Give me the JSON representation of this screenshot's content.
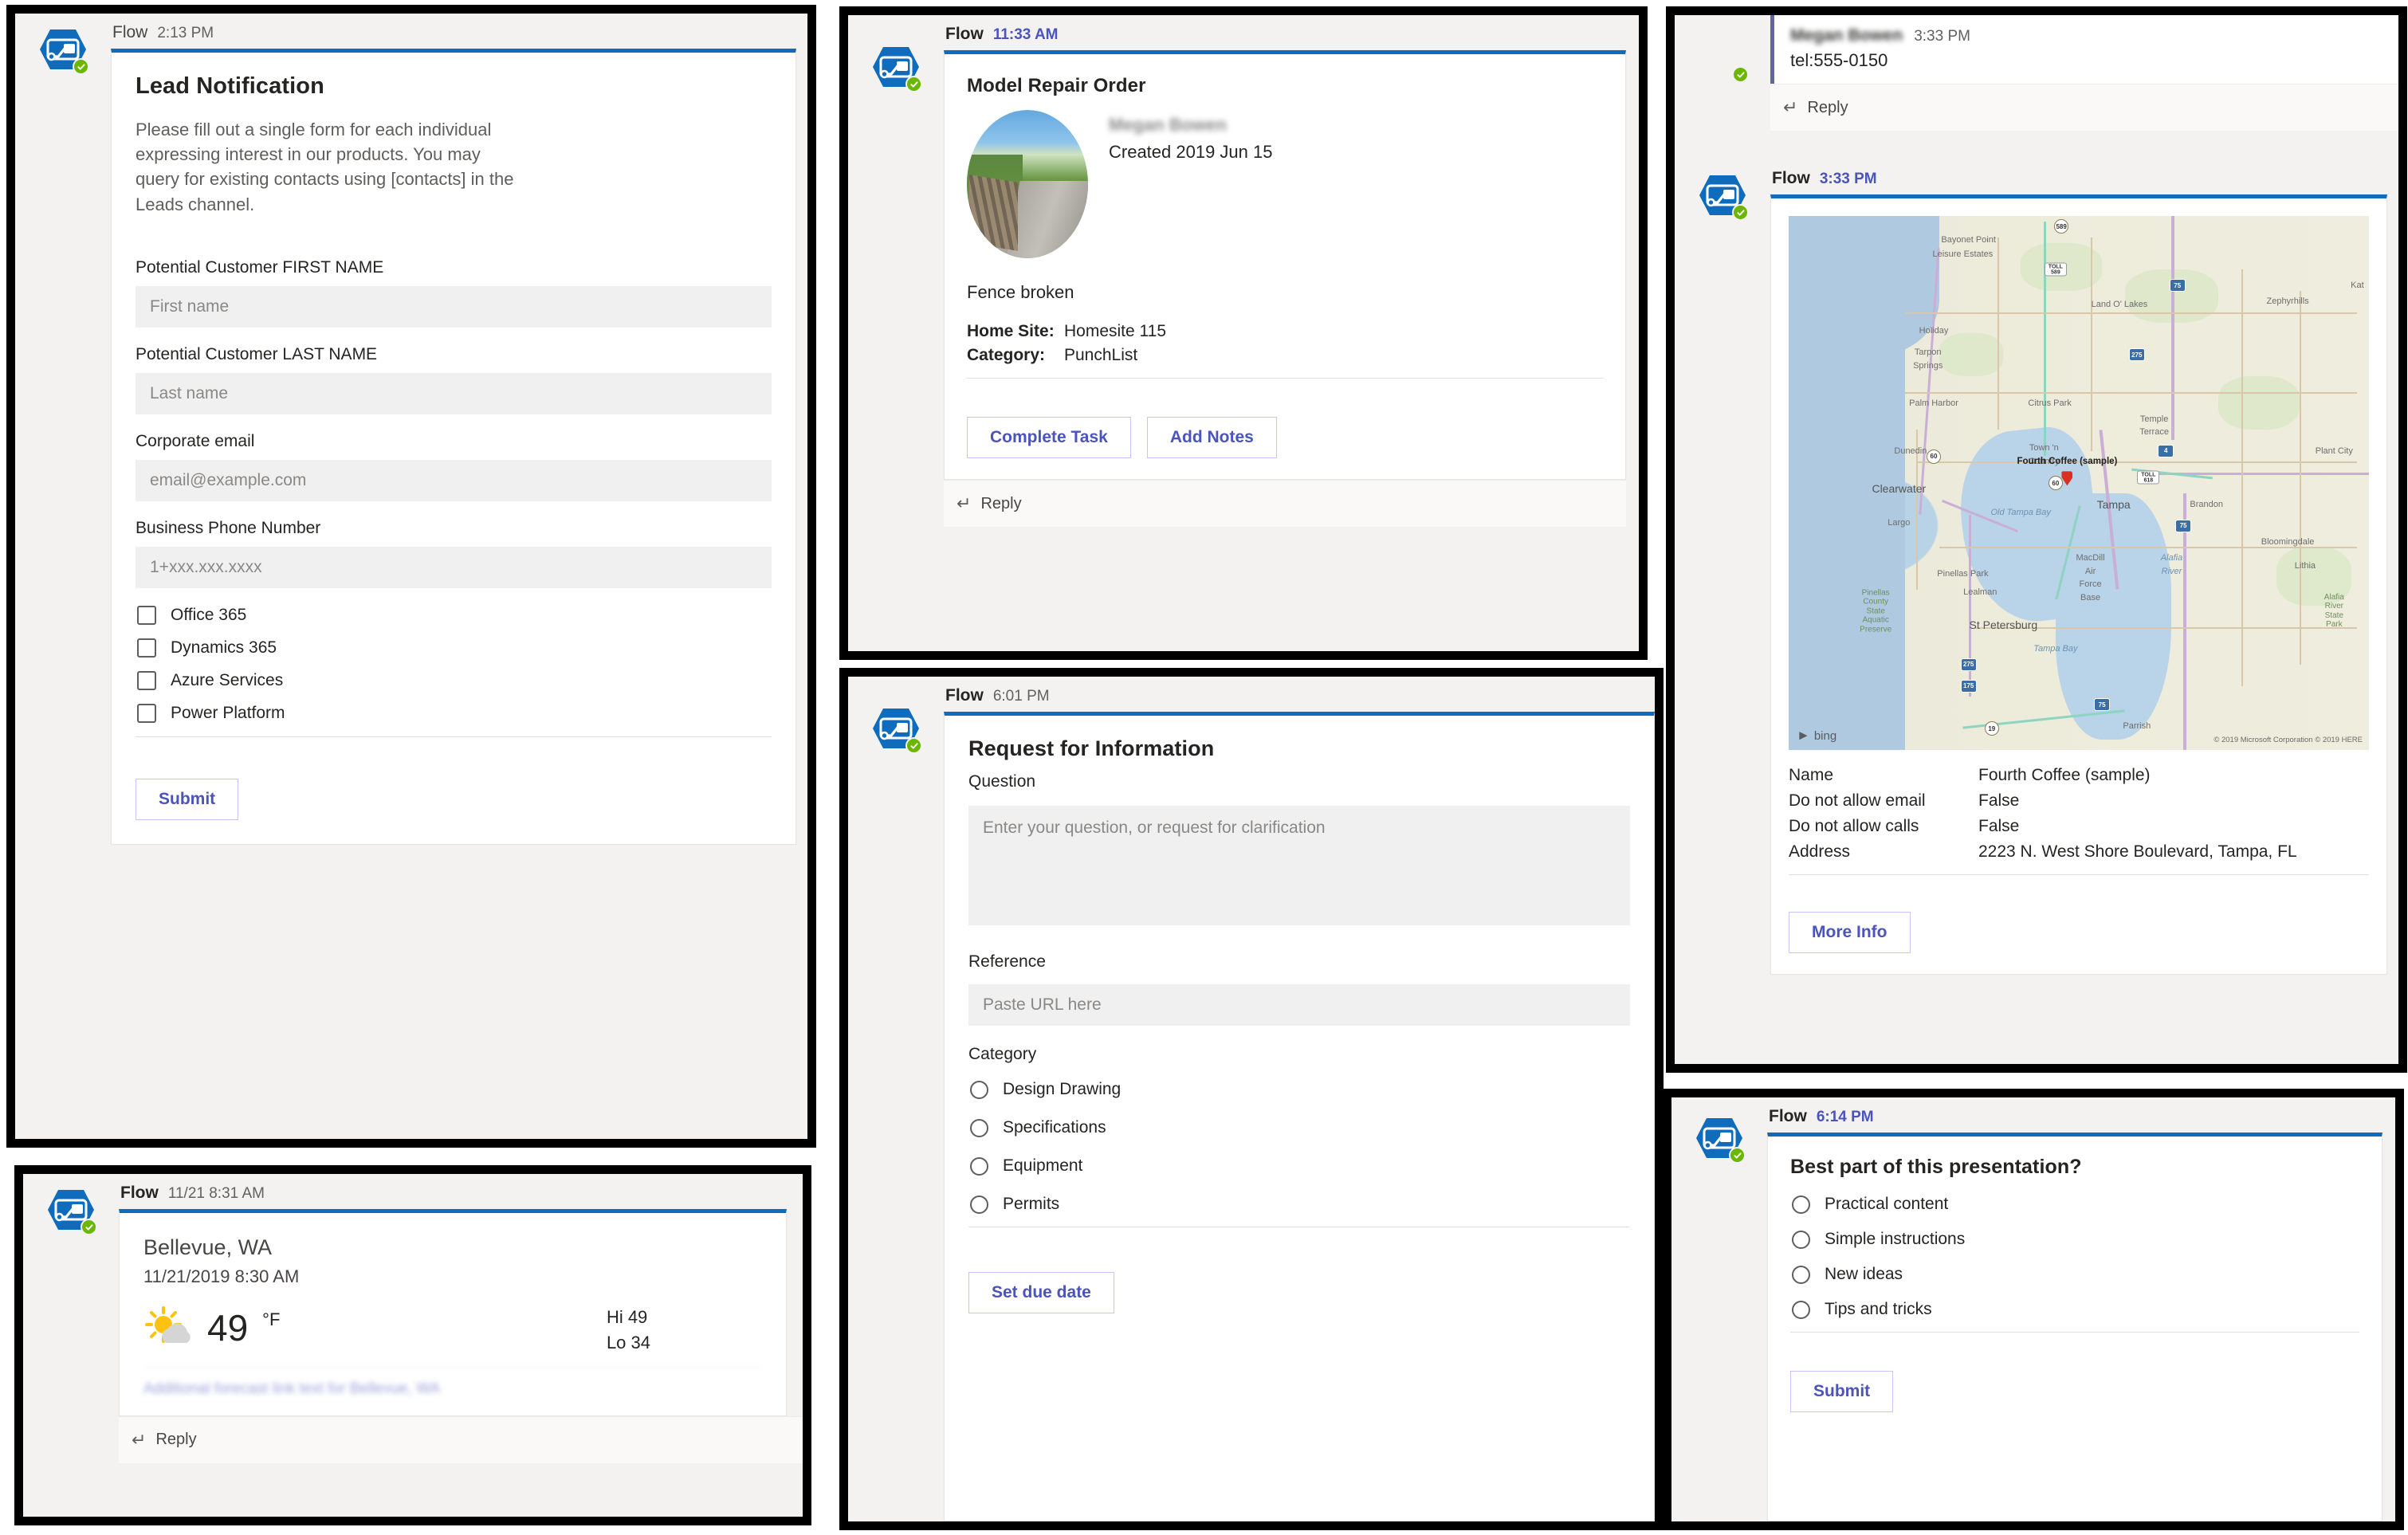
{
  "app": {
    "sender_name": "Flow",
    "reply_label": "Reply",
    "presence_icon": "check-badge-icon",
    "flow_icon": "power-automate-flow-icon"
  },
  "lead_card": {
    "sender": "Flow",
    "time": "2:13 PM",
    "title": "Lead Notification",
    "description": "Please fill out a single form for each individual expressing interest in our products. You may query for existing contacts using [contacts] in the Leads channel.",
    "fields": [
      {
        "label": "Potential Customer FIRST NAME",
        "placeholder": "First name"
      },
      {
        "label": "Potential Customer LAST NAME",
        "placeholder": "Last name"
      },
      {
        "label": "Corporate email",
        "placeholder": "email@example.com"
      },
      {
        "label": "Business Phone Number",
        "placeholder": "1+xxx.xxx.xxxx"
      }
    ],
    "checkboxes": [
      "Office 365",
      "Dynamics 365",
      "Azure Services",
      "Power Platform"
    ],
    "submit_label": "Submit"
  },
  "weather_card": {
    "sender": "Flow",
    "time": "11/21 8:31 AM",
    "city": "Bellevue, WA",
    "datetime": "11/21/2019 8:30 AM",
    "temperature": "49",
    "unit": "°F",
    "high": "Hi 49",
    "low": "Lo 34",
    "icon": "sun-behind-cloud-icon",
    "footer_blurred": "Additional forecast link text for Bellevue, WA",
    "reply_label": "Reply"
  },
  "repair_card": {
    "sender": "Flow",
    "time": "11:33 AM",
    "title": "Model Repair Order",
    "person": "Megan Bowen",
    "created": "Created 2019 Jun 15",
    "description": "Fence broken",
    "details": [
      {
        "key": "Home Site:",
        "value": "Homesite 115"
      },
      {
        "key": "Category:",
        "value": "PunchList"
      }
    ],
    "buttons": [
      "Complete Task",
      "Add Notes"
    ],
    "reply_label": "Reply",
    "photo_alt": "broken-fence-roadside-photo"
  },
  "rfi_card": {
    "sender": "Flow",
    "time": "6:01 PM",
    "title": "Request for Information",
    "question_label": "Question",
    "question_placeholder": "Enter your question, or request for clarification",
    "reference_label": "Reference",
    "reference_placeholder": "Paste URL here",
    "category_label": "Category",
    "categories": [
      "Design Drawing",
      "Specifications",
      "Equipment",
      "Permits"
    ],
    "action_label": "Set due date"
  },
  "contact_thread": {
    "person": "Megan Bowen",
    "time": "3:33 PM",
    "message": "tel:555-0150",
    "reply_label": "Reply"
  },
  "map_card": {
    "sender": "Flow",
    "time": "3:33 PM",
    "pin_label": "Fourth Coffee (sample)",
    "bing_label": "bing",
    "credit": "© 2019 Microsoft Corporation © 2019 HERE",
    "rows": [
      {
        "key": "Name",
        "value": "Fourth Coffee (sample)"
      },
      {
        "key": "Do not allow email",
        "value": "False"
      },
      {
        "key": "Do not allow calls",
        "value": "False"
      },
      {
        "key": "Address",
        "value": "2223 N. West Shore Boulevard, Tampa, FL"
      }
    ],
    "button_label": "More Info",
    "places": [
      "Bayonet Point",
      "Leisure Estates",
      "Land O' Lakes",
      "Zephyrhills",
      "Kat",
      "Holiday",
      "Tarpon Springs",
      "Palm Harbor",
      "Citrus Park",
      "Temple Terrace",
      "Dunedin",
      "Town 'n Country",
      "Plant City",
      "Clearwater",
      "Tampa",
      "Brandon",
      "Largo",
      "Pinellas Park",
      "Lealman",
      "Bloomingdale",
      "Lithia",
      "St Petersburg",
      "MacDill Air Force Base",
      "Parrish",
      "Old Tampa Bay",
      "Tampa Bay",
      "Alafia River",
      "Pinellas County State Aquatic Preserve",
      "Alafia River State Park"
    ]
  },
  "poll_card": {
    "sender": "Flow",
    "time": "6:14 PM",
    "question": "Best part of this presentation?",
    "options": [
      "Practical content",
      "Simple instructions",
      "New ideas",
      "Tips and tricks"
    ],
    "submit_label": "Submit"
  },
  "colors": {
    "card_accent": "#0f6cbd",
    "button_text": "#4b53bc",
    "presence_green": "#6bb700",
    "flow_blue": "#0f6cbd",
    "input_bg": "#f0f0f0",
    "panel_bg": "#f3f2f1"
  }
}
